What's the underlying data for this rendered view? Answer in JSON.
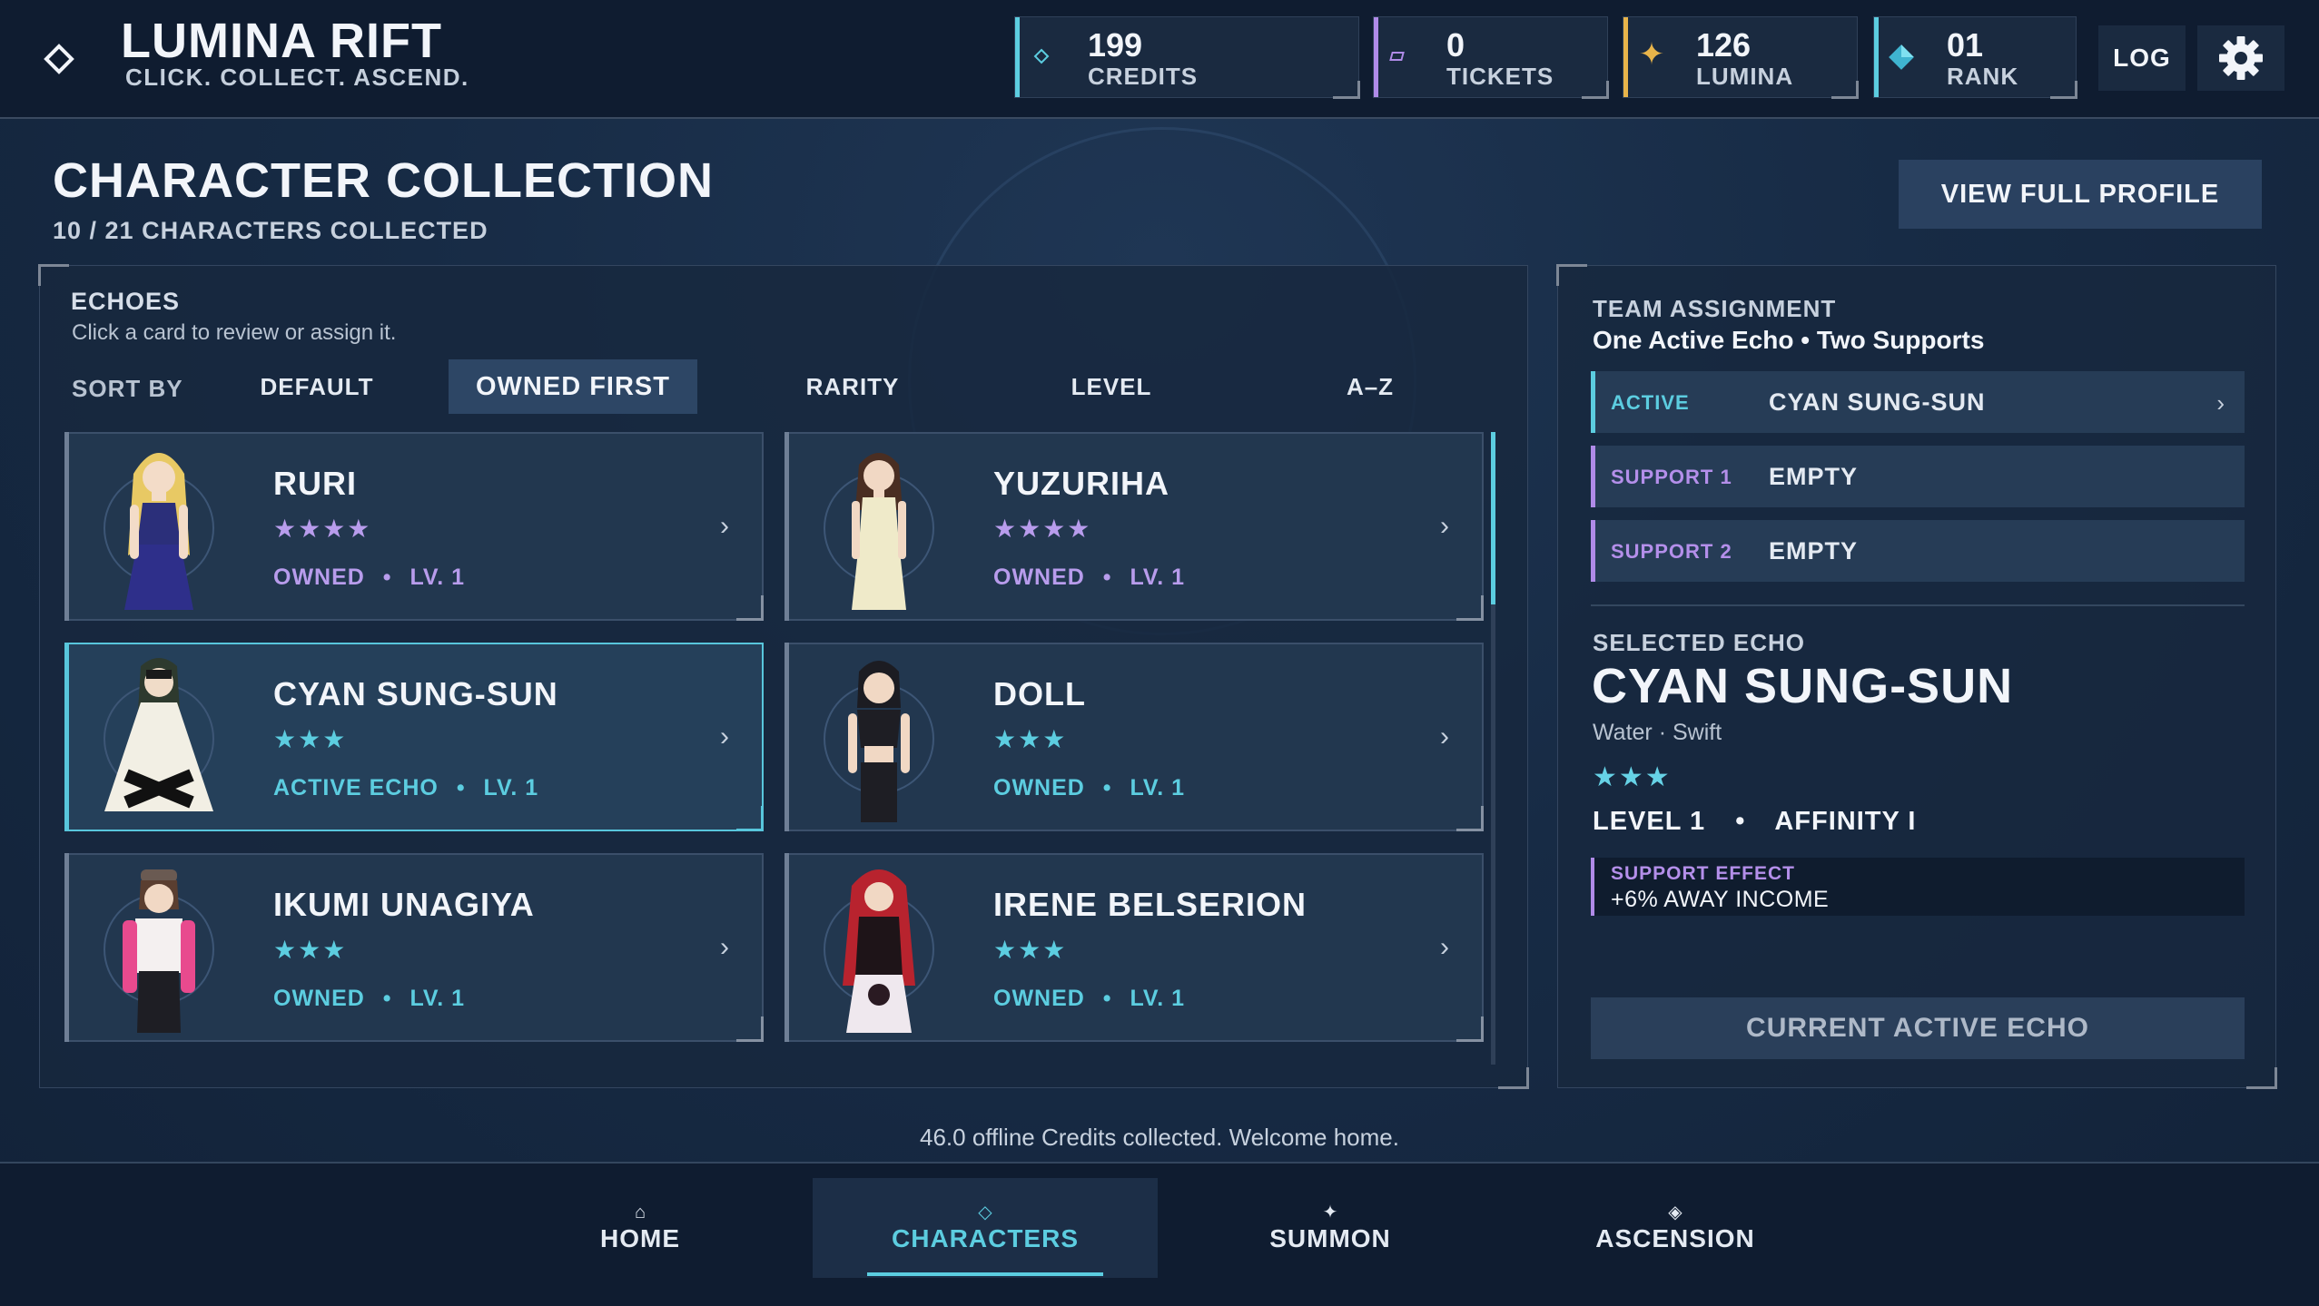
{
  "app": {
    "title": "LUMINA RIFT",
    "tagline": "CLICK. COLLECT. ASCEND."
  },
  "stats": [
    {
      "value": "199",
      "label": "CREDITS",
      "icon": "diamond-outline-icon",
      "color": "#5ccde0"
    },
    {
      "value": "0",
      "label": "TICKETS",
      "icon": "ticket-icon",
      "color": "#b08be8"
    },
    {
      "value": "126",
      "label": "LUMINA",
      "icon": "sparkle-icon",
      "color": "#e8b44a"
    },
    {
      "value": "01",
      "label": "RANK",
      "icon": "rank-gem-icon",
      "color": "#5ccde0"
    }
  ],
  "topbar": {
    "log_label": "LOG",
    "settings_icon": "gear-icon"
  },
  "header": {
    "title": "CHARACTER COLLECTION",
    "subtitle": "10 / 21 CHARACTERS COLLECTED",
    "profile_button": "VIEW FULL PROFILE"
  },
  "echoes": {
    "title": "ECHOES",
    "hint": "Click a card to review or assign it.",
    "sort_label": "SORT BY",
    "sort_options": [
      "DEFAULT",
      "OWNED FIRST",
      "RARITY",
      "LEVEL",
      "A–Z"
    ],
    "sort_selected": "OWNED FIRST",
    "cards": [
      {
        "name": "RURI",
        "stars": "★★★★",
        "status": "OWNED",
        "level": "LV. 1",
        "rarity_color": "#b89cec",
        "selected": false
      },
      {
        "name": "YUZURIHA",
        "stars": "★★★★",
        "status": "OWNED",
        "level": "LV. 1",
        "rarity_color": "#b89cec",
        "selected": false
      },
      {
        "name": "CYAN SUNG-SUN",
        "stars": "★★★",
        "status": "ACTIVE ECHO",
        "level": "LV. 1",
        "rarity_color": "#5ccde0",
        "selected": true
      },
      {
        "name": "DOLL",
        "stars": "★★★",
        "status": "OWNED",
        "level": "LV. 1",
        "rarity_color": "#5ccde0",
        "selected": false
      },
      {
        "name": "IKUMI UNAGIYA",
        "stars": "★★★",
        "status": "OWNED",
        "level": "LV. 1",
        "rarity_color": "#5ccde0",
        "selected": false
      },
      {
        "name": "IRENE BELSERION",
        "stars": "★★★",
        "status": "OWNED",
        "level": "LV. 1",
        "rarity_color": "#5ccde0",
        "selected": false
      }
    ]
  },
  "team": {
    "title": "TEAM ASSIGNMENT",
    "subtitle": "One Active Echo • Two Supports",
    "slots": [
      {
        "label": "ACTIVE",
        "value": "CYAN SUNG-SUN",
        "color": "#5ccde0",
        "chevron": "›"
      },
      {
        "label": "SUPPORT 1",
        "value": "EMPTY",
        "color": "#b08be8",
        "chevron": ""
      },
      {
        "label": "SUPPORT 2",
        "value": "EMPTY",
        "color": "#b08be8",
        "chevron": ""
      }
    ],
    "selected_label": "SELECTED ECHO",
    "selected_name": "CYAN SUNG-SUN",
    "selected_meta": "Water · Swift",
    "selected_stars": "★★★",
    "selected_level": "LEVEL 1",
    "selected_affinity": "AFFINITY I",
    "effect_label": "SUPPORT EFFECT",
    "effect_value": "+6% AWAY INCOME",
    "action_button": "CURRENT ACTIVE ECHO"
  },
  "status_message": "46.0 offline Credits collected. Welcome home.",
  "nav": [
    {
      "label": "HOME",
      "icon": "⌂"
    },
    {
      "label": "CHARACTERS",
      "icon": "◇"
    },
    {
      "label": "SUMMON",
      "icon": "✦"
    },
    {
      "label": "ASCENSION",
      "icon": "◈"
    }
  ],
  "nav_active": "CHARACTERS"
}
